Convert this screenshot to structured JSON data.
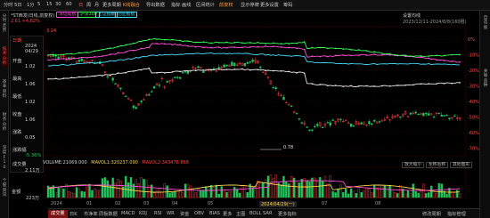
{
  "toolbar": {
    "items": [
      "分时",
      "5日",
      "1分",
      "5",
      "15",
      "30",
      "60",
      "日",
      "周",
      "月",
      "更多周期",
      "K线融合",
      "导出数据",
      "指标",
      "画线",
      "区间统计",
      "前复权",
      "显示停牌",
      "更多设置",
      "筹码"
    ],
    "active": "日",
    "highlighted": [
      "K线融合",
      "前复权"
    ]
  },
  "left_rail": [
    "分时走势",
    "技术分析",
    "基本资料",
    "财务分析",
    "深度F10",
    "个股资讯"
  ],
  "right_rail": [
    "自选股",
    "关联品种"
  ],
  "header": {
    "title": "*ST西发(日线,前复权)",
    "change": "2.61 +4.82%",
    "overlays": [
      "深证成指",
      "沪深300",
      "上证指数",
      "创业板指"
    ],
    "settings": "设置均线",
    "date_range": "2023/12/11-2024/8/8(160根)"
  },
  "info_panel": {
    "title": "日期",
    "date_year": "2024",
    "date_md": "04/29",
    "rows": [
      {
        "label": "开盘",
        "value": "1.02"
      },
      {
        "label": "最高",
        "value": "1.06"
      },
      {
        "label": "最低",
        "value": "1.02"
      },
      {
        "label": "收盘",
        "value": "1.06"
      },
      {
        "label": "涨跌",
        "value": "0.05"
      }
    ],
    "change_label": "涨跌幅",
    "change_pct": "-5.36%",
    "vol_label": "成交量",
    "vol": "2.11万",
    "amt_label": "金额",
    "amt": "223万"
  },
  "chart": {
    "right_axis": [
      "0%",
      "-10%",
      "-20%",
      "-30%",
      "-40%",
      "-50%",
      "-60%",
      "-70%"
    ],
    "marker_value": "0.78",
    "marker_date": "2024/04/29(一)",
    "zoom_labels": [
      "放大缩小",
      "左移右移",
      "其他图形"
    ],
    "vol_header": "VOLUME:21069.000",
    "mavol1": "MAVOL1:320237.090",
    "mavol2": "MAVOL2:343478.868",
    "x_labels": [
      "2024",
      "01",
      "02",
      "03",
      "04",
      "05",
      "06",
      "07",
      "08"
    ],
    "y_left_top": "3.24"
  },
  "bottom_tabs": [
    "成交量",
    "日K",
    "市净率",
    "同板数据",
    "MACD",
    "KDJ",
    "RSI",
    "WR",
    "资金",
    "OBV",
    "BIAS",
    "更多",
    "主图",
    "BOLL",
    "SAR",
    "更多指标",
    "修改周期",
    "指标管理"
  ],
  "bottom_active": "成交量",
  "colors": {
    "up": "#ff4040",
    "down": "#21c45b",
    "ma_white": "#e8e8e8",
    "ma_yellow": "#ffd24a",
    "ma_magenta": "#ff4fd8",
    "ma_green": "#35ff5a",
    "ma_cyan": "#45e0ff"
  }
}
